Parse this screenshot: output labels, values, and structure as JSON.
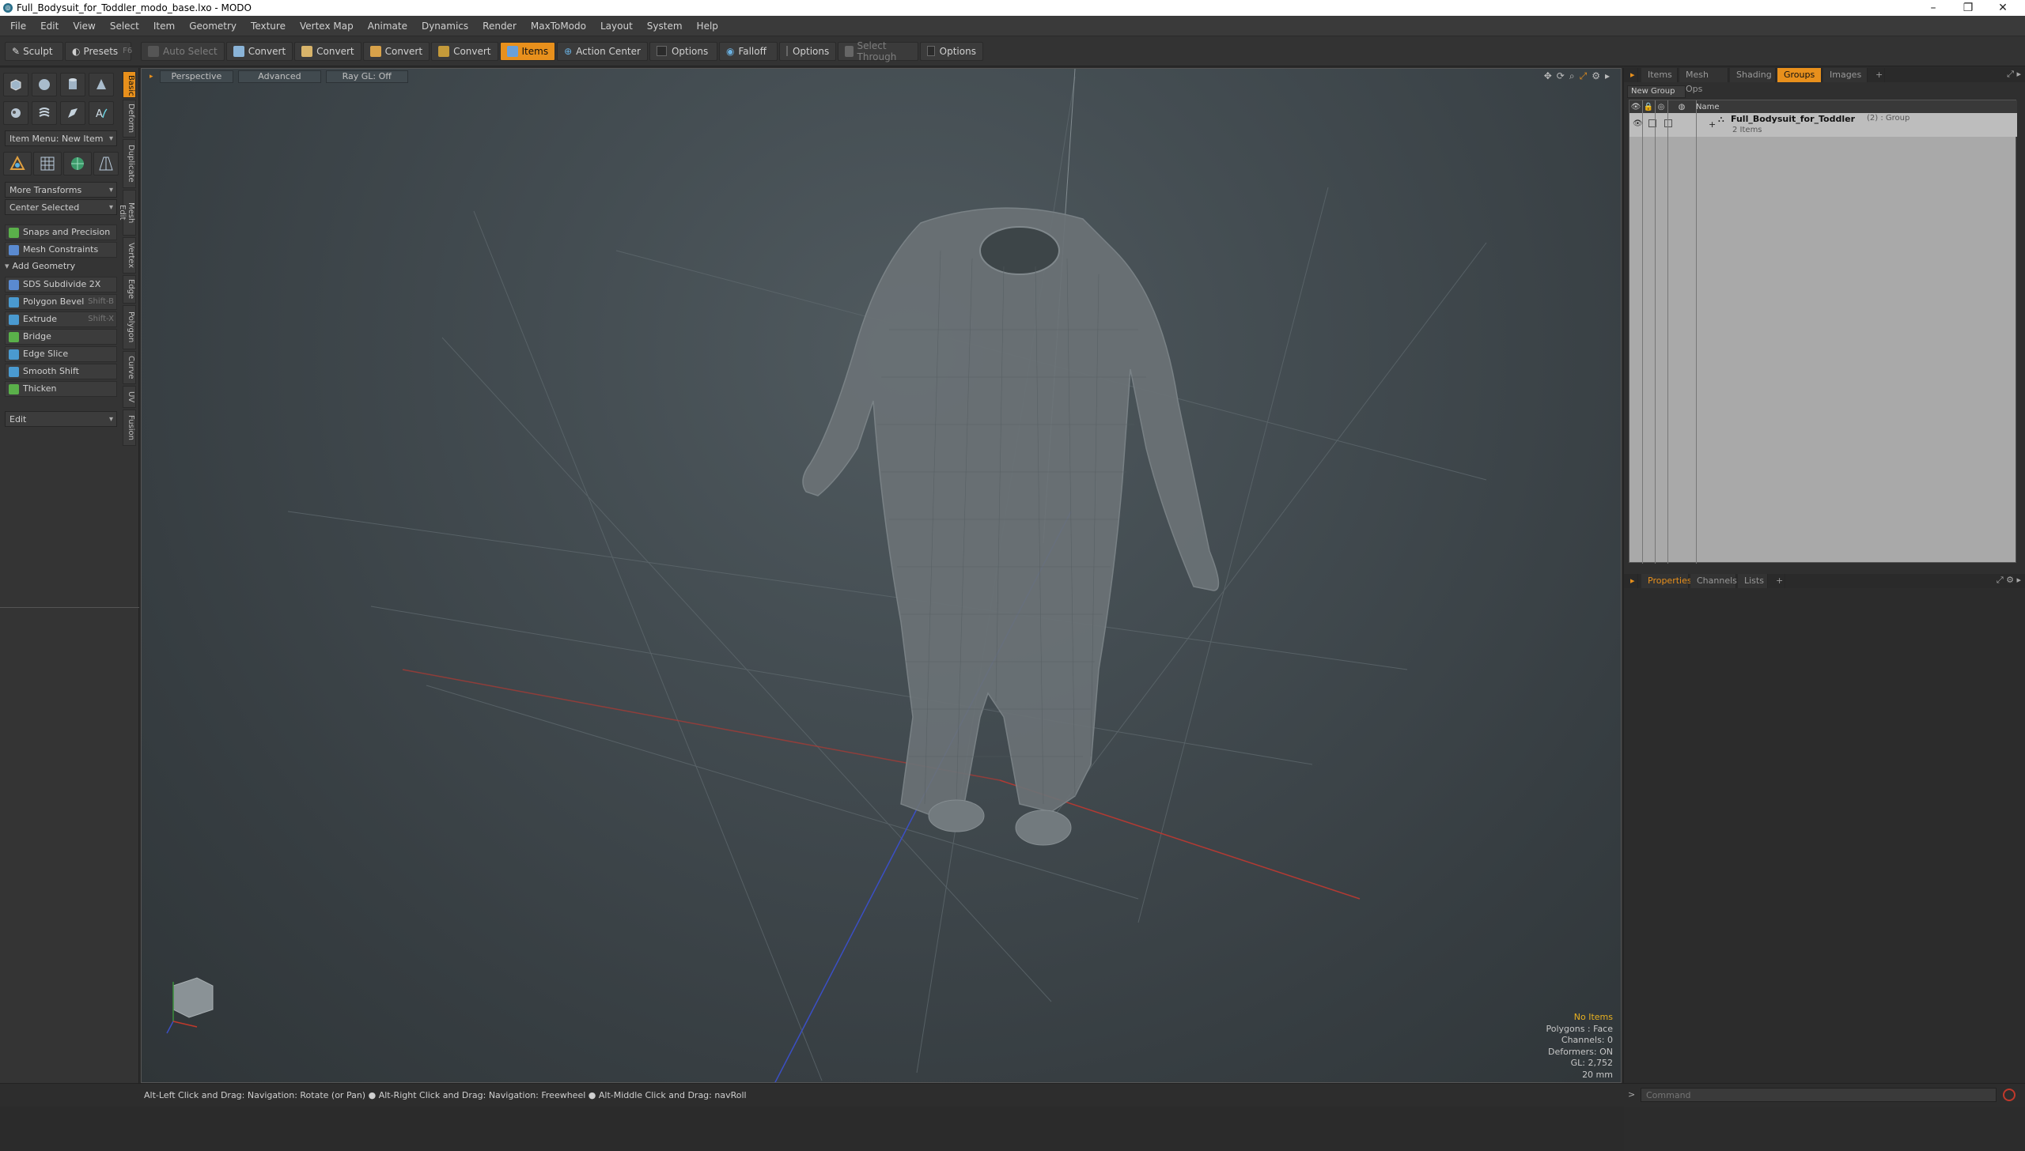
{
  "window": {
    "title": "Full_Bodysuit_for_Toddler_modo_base.lxo - MODO",
    "controls": [
      "–",
      "❐",
      "✕"
    ]
  },
  "menu": [
    "File",
    "Edit",
    "View",
    "Select",
    "Item",
    "Geometry",
    "Texture",
    "Vertex Map",
    "Animate",
    "Dynamics",
    "Render",
    "MaxToModo",
    "Layout",
    "System",
    "Help"
  ],
  "toolbar": {
    "sculpt": "Sculpt",
    "presets": "Presets",
    "presets_shortcut": "F6",
    "auto_select": "Auto Select",
    "convert1": "Convert",
    "convert2": "Convert",
    "convert3": "Convert",
    "convert4": "Convert",
    "items": "Items",
    "action_center": "Action Center",
    "options1": "Options",
    "falloff": "Falloff",
    "options2": "Options",
    "select_through": "Select Through",
    "options3": "Options"
  },
  "left": {
    "vertical_tabs": [
      "Basic",
      "Deform",
      "Duplicate",
      "Mesh Edit",
      "Vertex",
      "Edge",
      "Polygon",
      "Curve",
      "UV",
      "Fusion"
    ],
    "item_menu": "Item Menu: New Item",
    "more_transforms": "More Transforms",
    "center_selected": "Center Selected",
    "snaps": "Snaps and Precision",
    "mesh_constraints": "Mesh Constraints",
    "add_geometry": "Add Geometry",
    "tools": [
      {
        "label": "SDS Subdivide 2X",
        "shortcut": ""
      },
      {
        "label": "Polygon Bevel",
        "shortcut": "Shift-B"
      },
      {
        "label": "Extrude",
        "shortcut": "Shift-X"
      },
      {
        "label": "Bridge",
        "shortcut": ""
      },
      {
        "label": "Edge Slice",
        "shortcut": ""
      },
      {
        "label": "Smooth Shift",
        "shortcut": ""
      },
      {
        "label": "Thicken",
        "shortcut": ""
      }
    ],
    "edit": "Edit"
  },
  "viewport": {
    "perspective": "Perspective",
    "advanced": "Advanced",
    "raygl": "Ray GL: Off",
    "stats": {
      "no_items": "No Items",
      "polygons": "Polygons : Face",
      "channels": "Channels: 0",
      "deformers": "Deformers: ON",
      "gl": "GL: 2,752",
      "scale": "20 mm"
    },
    "colors": {
      "x_axis": "#c0392b",
      "y_axis": "#3a8f3a",
      "z_axis": "#3b4fc4",
      "mesh": "#6b7276"
    }
  },
  "right": {
    "tabs": [
      "Items",
      "Mesh Ops",
      "Shading",
      "Groups",
      "Images",
      "+"
    ],
    "new_group": "New Group",
    "col_name": "Name",
    "group_name": "Full_Bodysuit_for_Toddler",
    "group_count": "(2) : Group",
    "group_sub": "2 Items",
    "props_tabs": [
      "Properties",
      "Channels",
      "Lists",
      "+"
    ],
    "command_placeholder": "Command"
  },
  "status": {
    "hint": "Alt-Left Click and Drag: Navigation: Rotate (or Pan) ● Alt-Right Click and Drag: Navigation: Freewheel ● Alt-Middle Click and Drag: navRoll"
  }
}
